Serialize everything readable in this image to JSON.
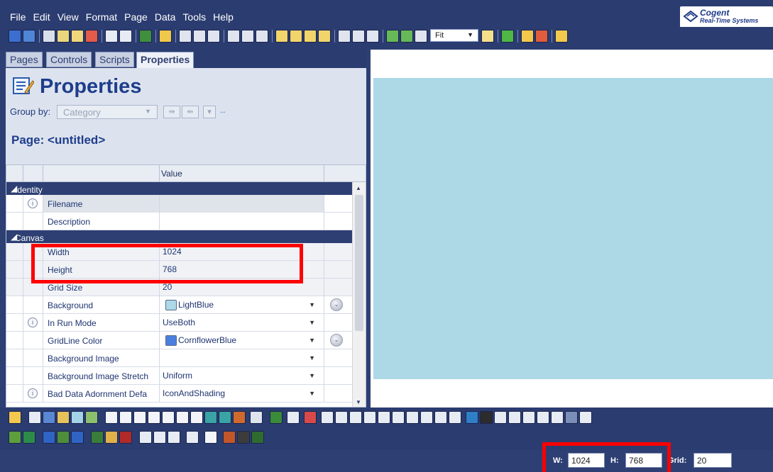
{
  "menu": [
    "File",
    "Edit",
    "View",
    "Format",
    "Page",
    "Data",
    "Tools",
    "Help"
  ],
  "logo": {
    "line1": "Cogent",
    "line2": "Real-Time Systems"
  },
  "toolbar": {
    "zoom_value": "Fit"
  },
  "tabs": [
    {
      "label": "Pages",
      "active": false
    },
    {
      "label": "Controls",
      "active": false
    },
    {
      "label": "Scripts",
      "active": false
    },
    {
      "label": "Properties",
      "active": true
    }
  ],
  "properties": {
    "title": "Properties",
    "group_by_label": "Group by:",
    "group_by_value": "Category",
    "page_title": "Page: <untitled>",
    "value_header": "Value"
  },
  "sections": {
    "identity": "Identity",
    "canvas": "Canvas"
  },
  "rows": {
    "filename": {
      "name": "Filename",
      "value": ""
    },
    "description": {
      "name": "Description",
      "value": ""
    },
    "width": {
      "name": "Width",
      "value": "1024"
    },
    "height": {
      "name": "Height",
      "value": "768"
    },
    "grid_size": {
      "name": "Grid Size",
      "value": "20"
    },
    "background": {
      "name": "Background",
      "value": "LightBlue",
      "swatch": "#add8e6"
    },
    "in_run_mode": {
      "name": "In Run Mode",
      "value": "UseBoth"
    },
    "gridline_color": {
      "name": "GridLine Color",
      "value": "CornflowerBlue",
      "swatch": "#4a7fe0"
    },
    "background_image": {
      "name": "Background Image",
      "value": ""
    },
    "background_image_stretch": {
      "name": "Background Image Stretch",
      "value": "Uniform"
    },
    "bad_data_adornment": {
      "name": "Bad Data Adornment Defa",
      "value": "IconAndShading"
    }
  },
  "canvas": {
    "color": "#add8e6"
  },
  "status": {
    "w_label": "W:",
    "w_value": "1024",
    "h_label": "H:",
    "h_value": "768",
    "grid_label": "Grid:",
    "grid_value": "20"
  },
  "colors": {
    "chrome": "#2d3f73",
    "highlight": "#ff0000",
    "title": "#1e3d8c"
  }
}
